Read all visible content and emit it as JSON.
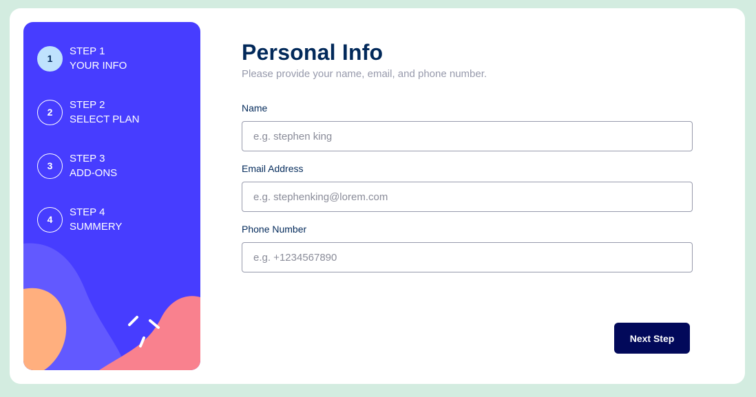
{
  "sidebar": {
    "steps": [
      {
        "number": "1",
        "step_label": "STEP 1",
        "name": "YOUR INFO",
        "active": true
      },
      {
        "number": "2",
        "step_label": "STEP 2",
        "name": "SELECT PLAN",
        "active": false
      },
      {
        "number": "3",
        "step_label": "STEP 3",
        "name": "ADD-ONS",
        "active": false
      },
      {
        "number": "4",
        "step_label": "STEP 4",
        "name": "SUMMERY",
        "active": false
      }
    ]
  },
  "form": {
    "title": "Personal Info",
    "subtitle": "Please provide your name, email, and phone number.",
    "name": {
      "label": "Name",
      "placeholder": "e.g. stephen king",
      "value": ""
    },
    "email": {
      "label": "Email Address",
      "placeholder": "e.g. stephenking@lorem.com",
      "value": ""
    },
    "phone": {
      "label": "Phone Number",
      "placeholder": "e.g. +1234567890",
      "value": ""
    },
    "next_label": "Next Step"
  },
  "colors": {
    "background": "#d3ece0",
    "sidebar": "#473dff",
    "active_step": "#bfe2fd",
    "button": "#02095a",
    "title": "#02295a"
  }
}
